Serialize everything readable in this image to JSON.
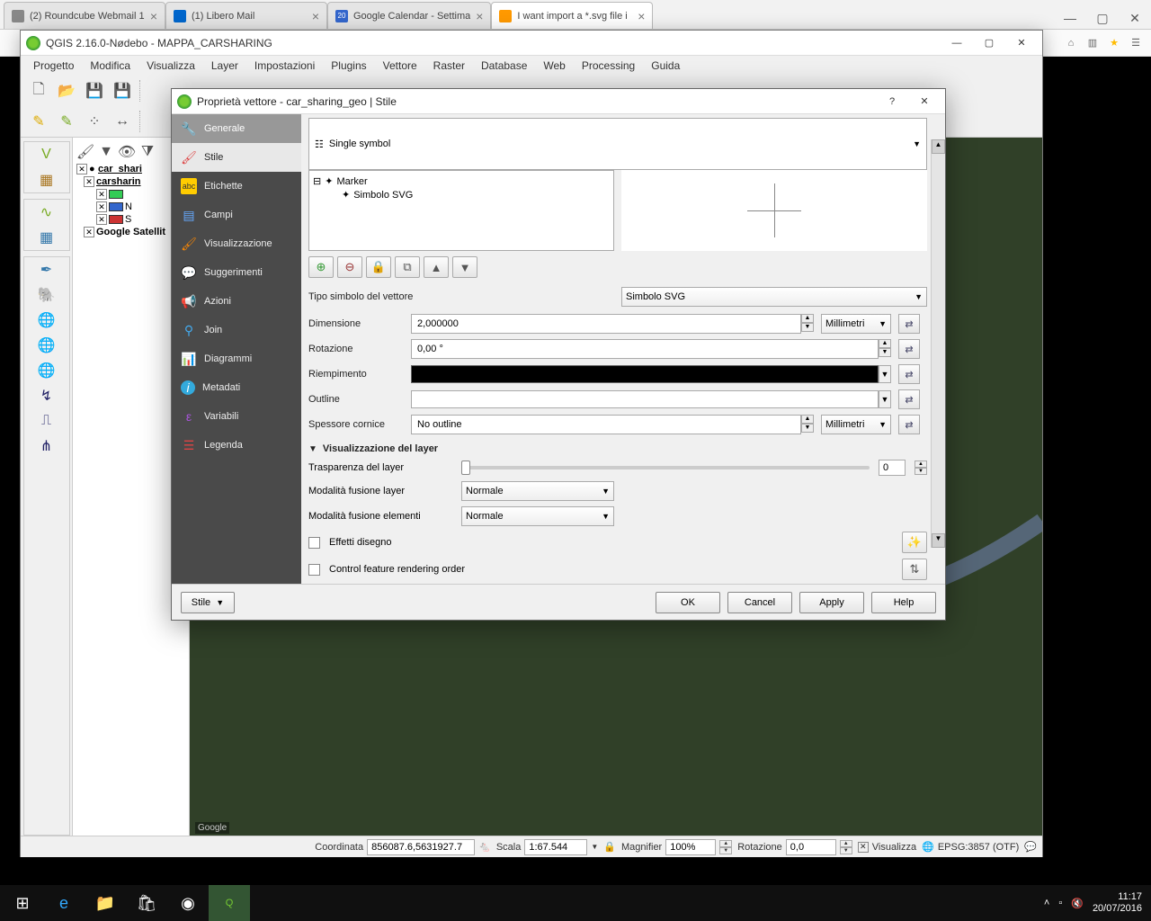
{
  "browser": {
    "tabs": [
      {
        "title": "(2) Roundcube Webmail 1"
      },
      {
        "title": "(1) Libero Mail"
      },
      {
        "title": "Google Calendar - Settima",
        "badge": "20"
      },
      {
        "title": "I want import a *.svg file i"
      }
    ]
  },
  "qgis": {
    "title": "QGIS 2.16.0-Nødebo - MAPPA_CARSHARING",
    "menu": [
      "Progetto",
      "Modifica",
      "Visualizza",
      "Layer",
      "Impostazioni",
      "Plugins",
      "Vettore",
      "Raster",
      "Database",
      "Web",
      "Processing",
      "Guida"
    ],
    "layers": {
      "root": "car_shari",
      "group": "carsharin",
      "item_n": "N",
      "item_s": "S",
      "base": "Google Satellit"
    },
    "map_attrib_left": "Google",
    "status": {
      "coord_label": "Coordinata",
      "coord_value": "856087.6,5631927.7",
      "scale_label": "Scala",
      "scale_value": "1:67.544",
      "magnifier_label": "Magnifier",
      "magnifier_value": "100%",
      "rotation_label": "Rotazione",
      "rotation_value": "0,0",
      "render_label": "Visualizza",
      "crs": "EPSG:3857 (OTF)"
    }
  },
  "dialog": {
    "title": "Proprietà vettore - car_sharing_geo | Stile",
    "sidebar": {
      "generale": "Generale",
      "stile": "Stile",
      "etichette": "Etichette",
      "campi": "Campi",
      "visualizzazione": "Visualizzazione",
      "suggerimenti": "Suggerimenti",
      "azioni": "Azioni",
      "join": "Join",
      "diagrammi": "Diagrammi",
      "metadati": "Metadati",
      "variabili": "Variabili",
      "legenda": "Legenda"
    },
    "symbol_type": "Single symbol",
    "tree": {
      "marker": "Marker",
      "svg": "Simbolo SVG"
    },
    "form": {
      "tipo_label": "Tipo simbolo del vettore",
      "tipo_value": "Simbolo SVG",
      "dimensione_label": "Dimensione",
      "dimensione_value": "2,000000",
      "unit1": "Millimetri",
      "rotazione_label": "Rotazione",
      "rotazione_value": "0,00 °",
      "riempimento_label": "Riempimento",
      "outline_label": "Outline",
      "spessore_label": "Spessore cornice",
      "spessore_value": "No outline",
      "unit2": "Millimetri"
    },
    "viz": {
      "header": "Visualizzazione del layer",
      "transparency": "Trasparenza del layer",
      "transparency_value": "0",
      "blend_layer_label": "Modalità fusione layer",
      "blend_layer_value": "Normale",
      "blend_feature_label": "Modalità fusione elementi",
      "blend_feature_value": "Normale",
      "draw_effects": "Effetti disegno",
      "feature_order": "Control feature rendering order"
    },
    "footer": {
      "stile": "Stile",
      "ok": "OK",
      "cancel": "Cancel",
      "apply": "Apply",
      "help": "Help"
    }
  },
  "taskbar": {
    "time": "11:17",
    "date": "20/07/2016"
  }
}
